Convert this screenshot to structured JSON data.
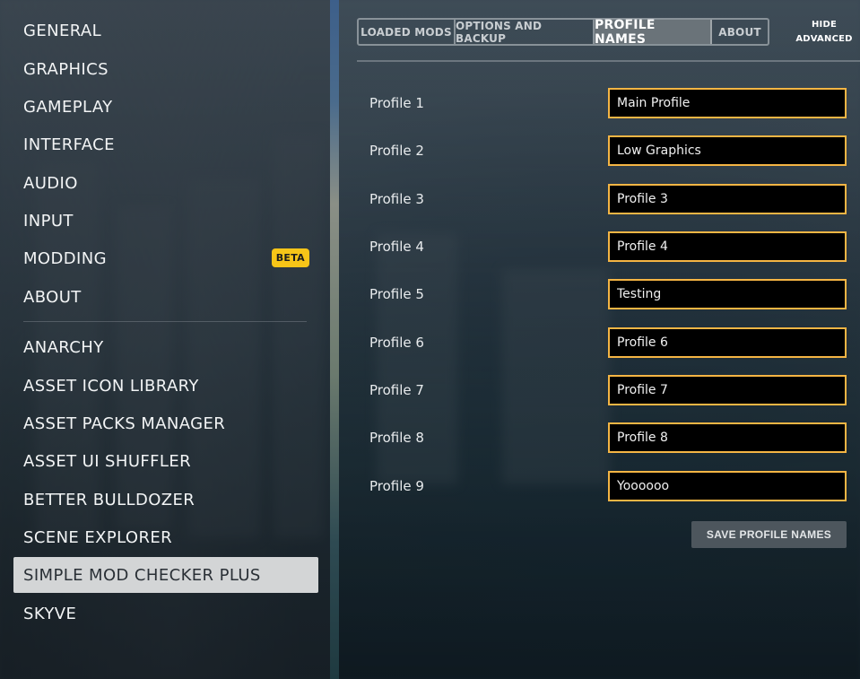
{
  "sidebar": {
    "items": [
      {
        "label": "GENERAL"
      },
      {
        "label": "GRAPHICS"
      },
      {
        "label": "GAMEPLAY"
      },
      {
        "label": "INTERFACE"
      },
      {
        "label": "AUDIO"
      },
      {
        "label": "INPUT"
      },
      {
        "label": "MODDING",
        "badge": "BETA"
      },
      {
        "label": "ABOUT"
      }
    ],
    "mods": [
      {
        "label": "ANARCHY"
      },
      {
        "label": "ASSET ICON LIBRARY"
      },
      {
        "label": "ASSET PACKS MANAGER"
      },
      {
        "label": "ASSET UI SHUFFLER"
      },
      {
        "label": "BETTER BULLDOZER"
      },
      {
        "label": "SCENE EXPLORER"
      },
      {
        "label": "SIMPLE MOD CHECKER PLUS",
        "active": true
      },
      {
        "label": "SKYVE"
      }
    ]
  },
  "tabs": [
    {
      "label": "LOADED MODS"
    },
    {
      "label": "OPTIONS AND BACKUP"
    },
    {
      "label": "PROFILE NAMES",
      "active": true
    },
    {
      "label": "ABOUT"
    }
  ],
  "hide_advanced": {
    "line1": "HIDE",
    "line2": "ADVANCED"
  },
  "profiles": [
    {
      "label": "Profile 1",
      "value": "Main Profile"
    },
    {
      "label": "Profile 2",
      "value": "Low Graphics"
    },
    {
      "label": "Profile 3",
      "value": "Profile 3"
    },
    {
      "label": "Profile 4",
      "value": "Profile 4"
    },
    {
      "label": "Profile 5",
      "value": "Testing"
    },
    {
      "label": "Profile 6",
      "value": "Profile 6"
    },
    {
      "label": "Profile 7",
      "value": "Profile 7"
    },
    {
      "label": "Profile 8",
      "value": "Profile 8"
    },
    {
      "label": "Profile 9",
      "value": "Yoooooo"
    }
  ],
  "save_button": "SAVE PROFILE NAMES",
  "colors": {
    "input_border": "#f5b544",
    "beta_badge": "#f7c518",
    "active_nav": "#d3d5d6",
    "active_tab": "#6a7379"
  }
}
